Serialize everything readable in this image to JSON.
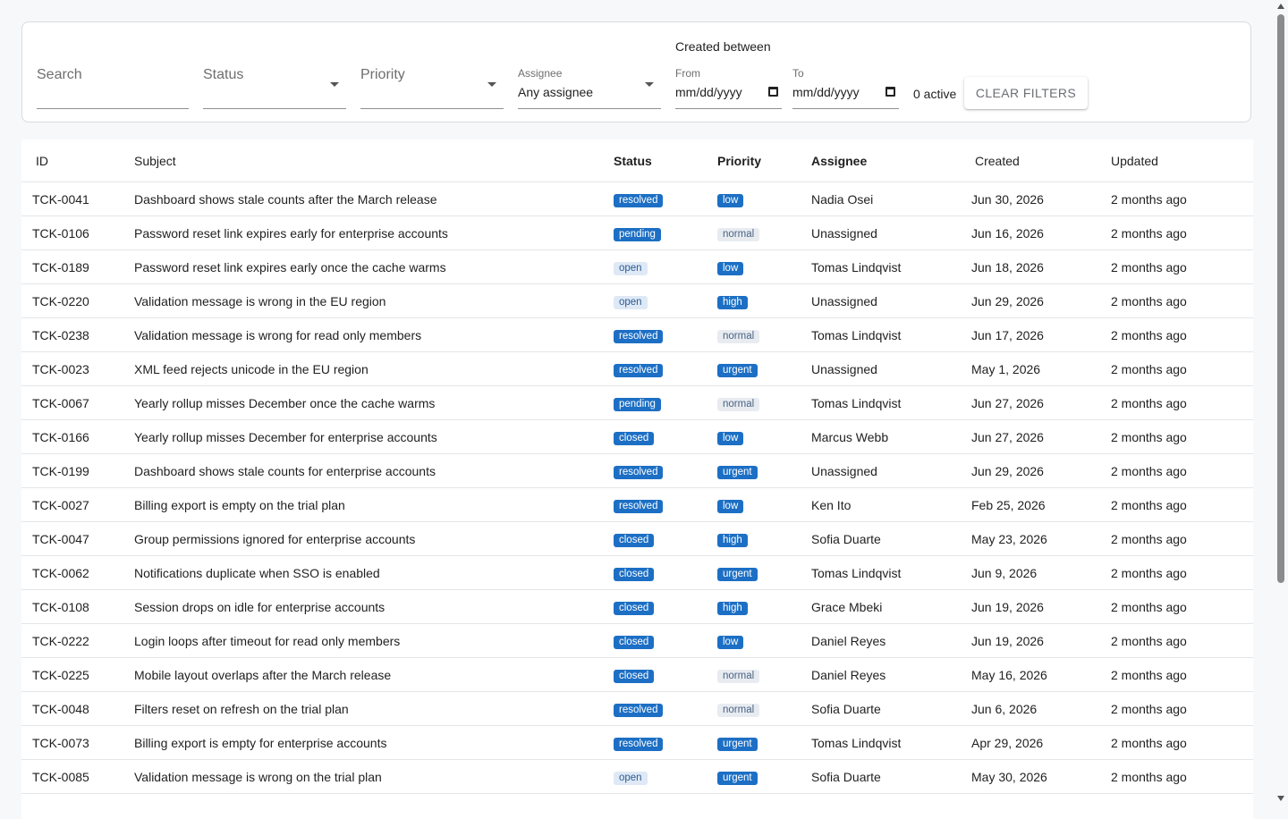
{
  "filters": {
    "search_placeholder": "Search",
    "status_placeholder": "Status",
    "priority_placeholder": "Priority",
    "assignee_label": "Assignee",
    "assignee_value": "Any assignee",
    "created_between": "Created between",
    "from_label": "From",
    "from_value": "mm/dd/yyyy",
    "to_label": "To",
    "to_value": "mm/dd/yyyy",
    "active_count": "0 active",
    "clear_label": "Clear filters"
  },
  "table": {
    "columns": [
      "ID",
      "Subject",
      "Status",
      "Priority",
      "Assignee",
      "Created",
      "Updated"
    ],
    "rows": [
      {
        "id": "TCK-0041",
        "subject": "Dashboard shows stale counts after the March release",
        "status": "resolved",
        "priority": "low",
        "assignee": "Nadia Osei",
        "created": "Jun 30, 2026",
        "updated": "2 months ago"
      },
      {
        "id": "TCK-0106",
        "subject": "Password reset link expires early for enterprise accounts",
        "status": "pending",
        "priority": "normal",
        "assignee": "Unassigned",
        "created": "Jun 16, 2026",
        "updated": "2 months ago"
      },
      {
        "id": "TCK-0189",
        "subject": "Password reset link expires early once the cache warms",
        "status": "open",
        "priority": "low",
        "assignee": "Tomas Lindqvist",
        "created": "Jun 18, 2026",
        "updated": "2 months ago"
      },
      {
        "id": "TCK-0220",
        "subject": "Validation message is wrong in the EU region",
        "status": "open",
        "priority": "high",
        "assignee": "Unassigned",
        "created": "Jun 29, 2026",
        "updated": "2 months ago"
      },
      {
        "id": "TCK-0238",
        "subject": "Validation message is wrong for read only members",
        "status": "resolved",
        "priority": "normal",
        "assignee": "Tomas Lindqvist",
        "created": "Jun 17, 2026",
        "updated": "2 months ago"
      },
      {
        "id": "TCK-0023",
        "subject": "XML feed rejects unicode in the EU region",
        "status": "resolved",
        "priority": "urgent",
        "assignee": "Unassigned",
        "created": "May 1, 2026",
        "updated": "2 months ago"
      },
      {
        "id": "TCK-0067",
        "subject": "Yearly rollup misses December once the cache warms",
        "status": "pending",
        "priority": "normal",
        "assignee": "Tomas Lindqvist",
        "created": "Jun 27, 2026",
        "updated": "2 months ago"
      },
      {
        "id": "TCK-0166",
        "subject": "Yearly rollup misses December for enterprise accounts",
        "status": "closed",
        "priority": "low",
        "assignee": "Marcus Webb",
        "created": "Jun 27, 2026",
        "updated": "2 months ago"
      },
      {
        "id": "TCK-0199",
        "subject": "Dashboard shows stale counts for enterprise accounts",
        "status": "resolved",
        "priority": "urgent",
        "assignee": "Unassigned",
        "created": "Jun 29, 2026",
        "updated": "2 months ago"
      },
      {
        "id": "TCK-0027",
        "subject": "Billing export is empty on the trial plan",
        "status": "resolved",
        "priority": "low",
        "assignee": "Ken Ito",
        "created": "Feb 25, 2026",
        "updated": "2 months ago"
      },
      {
        "id": "TCK-0047",
        "subject": "Group permissions ignored for enterprise accounts",
        "status": "closed",
        "priority": "high",
        "assignee": "Sofia Duarte",
        "created": "May 23, 2026",
        "updated": "2 months ago"
      },
      {
        "id": "TCK-0062",
        "subject": "Notifications duplicate when SSO is enabled",
        "status": "closed",
        "priority": "urgent",
        "assignee": "Tomas Lindqvist",
        "created": "Jun 9, 2026",
        "updated": "2 months ago"
      },
      {
        "id": "TCK-0108",
        "subject": "Session drops on idle for enterprise accounts",
        "status": "closed",
        "priority": "high",
        "assignee": "Grace Mbeki",
        "created": "Jun 19, 2026",
        "updated": "2 months ago"
      },
      {
        "id": "TCK-0222",
        "subject": "Login loops after timeout for read only members",
        "status": "closed",
        "priority": "low",
        "assignee": "Daniel Reyes",
        "created": "Jun 19, 2026",
        "updated": "2 months ago"
      },
      {
        "id": "TCK-0225",
        "subject": "Mobile layout overlaps after the March release",
        "status": "closed",
        "priority": "normal",
        "assignee": "Daniel Reyes",
        "created": "May 16, 2026",
        "updated": "2 months ago"
      },
      {
        "id": "TCK-0048",
        "subject": "Filters reset on refresh on the trial plan",
        "status": "resolved",
        "priority": "normal",
        "assignee": "Sofia Duarte",
        "created": "Jun 6, 2026",
        "updated": "2 months ago"
      },
      {
        "id": "TCK-0073",
        "subject": "Billing export is empty for enterprise accounts",
        "status": "resolved",
        "priority": "urgent",
        "assignee": "Tomas Lindqvist",
        "created": "Apr 29, 2026",
        "updated": "2 months ago"
      },
      {
        "id": "TCK-0085",
        "subject": "Validation message is wrong on the trial plan",
        "status": "open",
        "priority": "urgent",
        "assignee": "Sofia Duarte",
        "created": "May 30, 2026",
        "updated": "2 months ago"
      }
    ]
  },
  "colors": {
    "badge_dark": "#1c6fc4",
    "badge_light_bg": "#dfe9f6",
    "badge_gray_bg": "#e8ecf1"
  }
}
